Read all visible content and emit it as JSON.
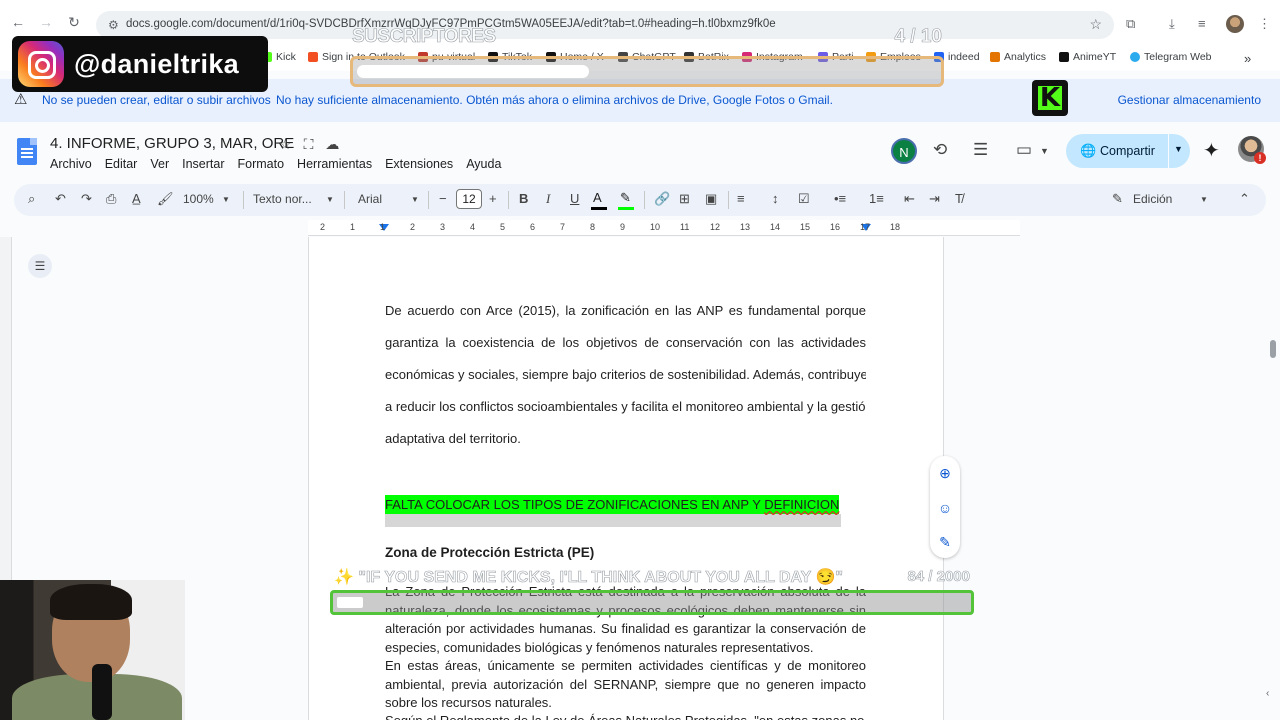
{
  "browser": {
    "url": "docs.google.com/document/d/1ri0q-SVDCBDrfXmzrrWqDJyFC97PmPCGtm5WA05EEJA/edit?tab=t.0#heading=h.tl0bxmz9fk0e"
  },
  "bookmarks": [
    {
      "label": "Kick",
      "color": "#53fc18"
    },
    {
      "label": "Sign in to Outlook",
      "color": "#f25022"
    },
    {
      "label": "pu-virtual",
      "color": "#c0392b"
    },
    {
      "label": "TikTok",
      "color": "#111111"
    },
    {
      "label": "Home / X",
      "color": "#111111"
    },
    {
      "label": "ChatGPT",
      "color": "#444444"
    },
    {
      "label": "BotRix",
      "color": "#333333"
    },
    {
      "label": "Instagram",
      "color": "#d62976"
    },
    {
      "label": "Parti",
      "color": "#6c5ce7"
    },
    {
      "label": "Empleos",
      "color": "#f39c12"
    },
    {
      "label": "indeed",
      "color": "#2164f3"
    },
    {
      "label": "Analytics",
      "color": "#e37400"
    },
    {
      "label": "AnimeYT",
      "color": "#111111"
    },
    {
      "label": "Telegram Web",
      "color": "#2aabee"
    }
  ],
  "overlay": {
    "instagram_handle": "@danieltrika",
    "subs_title": "SUSCRIPTORES",
    "subs_count": "4 / 10",
    "subs_progress": 0.4,
    "kicks_text": "✨ \"IF YOU SEND ME KICKS, I'LL THINK ABOUT YOU ALL DAY 😏\"",
    "kicks_count": "84 / 2000",
    "kicks_progress": 0.042
  },
  "warning": {
    "title": "No se pueden crear, editar o subir archivos",
    "text": "No hay suficiente almacenamiento. Obtén más ahora o elimina archivos de Drive, Google Fotos o Gmail.",
    "action": "Gestionar almacenamiento"
  },
  "docs": {
    "title": "4. INFORME, GRUPO 3, MAR, ORE",
    "menu": [
      "Archivo",
      "Editar",
      "Ver",
      "Insertar",
      "Formato",
      "Herramientas",
      "Extensiones",
      "Ayuda"
    ],
    "avatar_letter": "N",
    "share_label": "Compartir",
    "toolbar": {
      "zoom": "100%",
      "style": "Texto nor...",
      "font": "Arial",
      "font_size": "12",
      "mode": "Edición"
    },
    "ruler": [
      "2",
      "1",
      "1",
      "2",
      "3",
      "4",
      "5",
      "6",
      "7",
      "8",
      "9",
      "10",
      "11",
      "12",
      "13",
      "14",
      "15",
      "16",
      "17",
      "18"
    ]
  },
  "document": {
    "para1_lines": [
      "De acuerdo con Arce (2015), la zonificación en las ANP es fundamental porque",
      "garantiza la coexistencia de los objetivos de conservación con las actividades",
      "económicas y sociales, siempre bajo criterios de sostenibilidad. Además, contribuye",
      "a reducir los conflictos socioambientales y facilita el monitoreo ambiental y la gestión",
      "adaptativa del territorio."
    ],
    "highlight_main": "FALTA COLOCAR LOS TIPOS DE ZONIFICACIONES EN ANP Y ",
    "highlight_misspelled": "DEFINICION",
    "heading": "Zona de Protección Estricta (PE)",
    "para2_lines": [
      "La Zona de Protección Estricta está destinada a la preservación absoluta de la",
      "naturaleza, donde los ecosistemas y procesos ecológicos deben mantenerse sin",
      "alteración por actividades humanas. Su finalidad es garantizar la conservación de",
      "especies, comunidades biológicas y fenómenos naturales representativos."
    ],
    "para3_lines": [
      "En estas áreas, únicamente se permiten actividades científicas y de monitoreo",
      "ambiental, previa autorización del SERNANP, siempre que no generen impacto",
      "sobre los recursos naturales."
    ],
    "para4_partial": "Según el Reglamento de la Ley de Áreas Naturales Protegidas, \"en estas zonas no"
  }
}
